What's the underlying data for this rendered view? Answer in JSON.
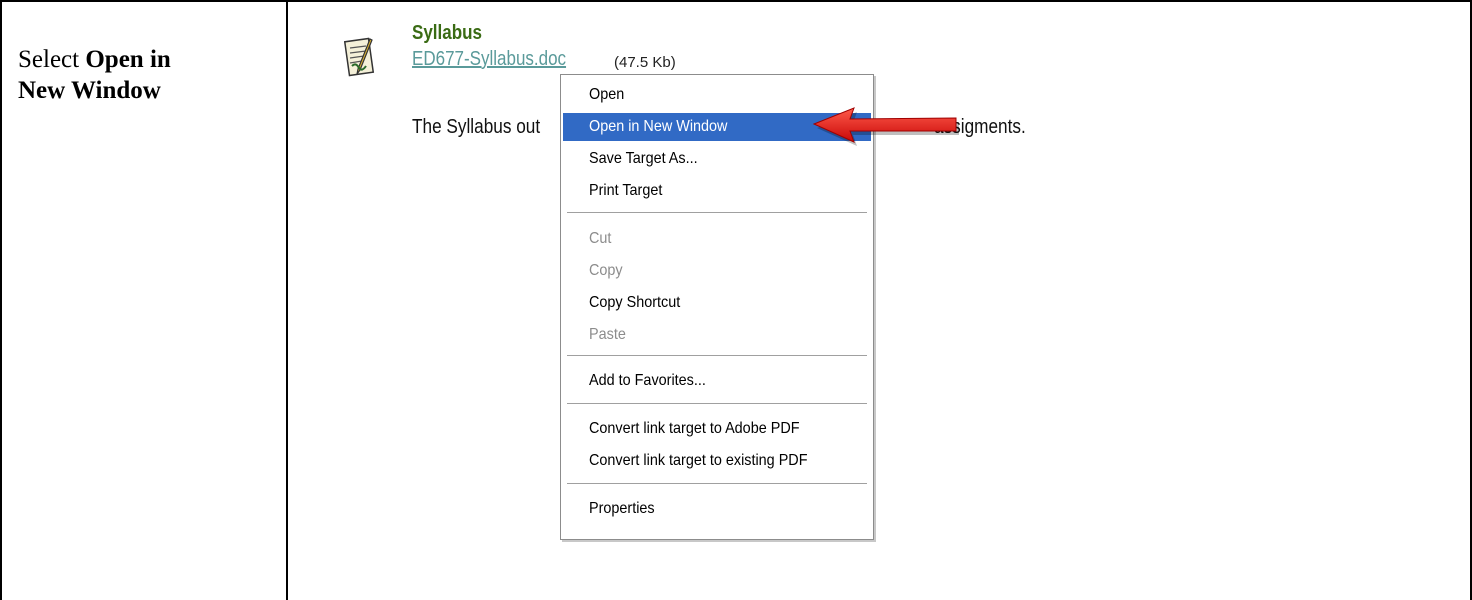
{
  "instruction": {
    "prefix": "Select ",
    "bold1": "Open in",
    "bold2": "New Window"
  },
  "item": {
    "title": "Syllabus",
    "link_text": "ED677-Syllabus.doc",
    "file_size": "(47.5 Kb)",
    "desc_left": "The Syllabus out",
    "desc_right": "assigments.",
    "icon": "document-with-pencil-icon"
  },
  "context_menu": {
    "items": [
      {
        "label": "Open"
      },
      {
        "label": "Open in New Window",
        "highlighted": true
      },
      {
        "label": "Save Target As..."
      },
      {
        "label": "Print Target"
      },
      {
        "label": "Cut",
        "disabled": true
      },
      {
        "label": "Copy",
        "disabled": true
      },
      {
        "label": "Copy Shortcut"
      },
      {
        "label": "Paste",
        "disabled": true
      },
      {
        "label": "Add to Favorites..."
      },
      {
        "label": "Convert link target to Adobe PDF"
      },
      {
        "label": "Convert link target to existing PDF"
      },
      {
        "label": "Properties"
      }
    ],
    "highlight_color": "#316ac5"
  },
  "annotation": {
    "icon": "red-arrow-icon",
    "color": "#e01010"
  },
  "colors": {
    "title": "#3a6b14",
    "link": "#5a9a9a"
  }
}
